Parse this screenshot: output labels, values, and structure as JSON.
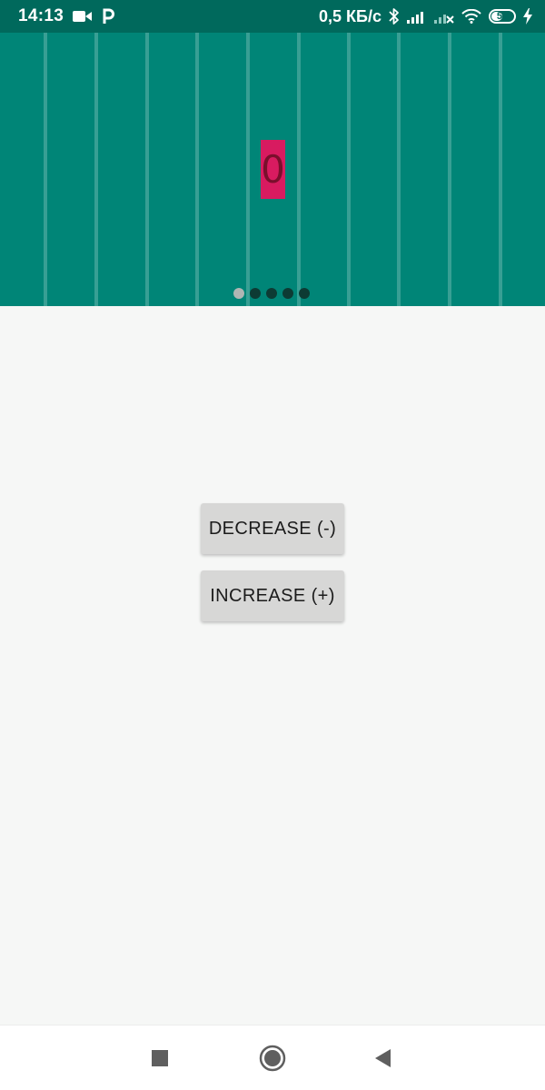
{
  "status_bar": {
    "time": "14:13",
    "network_speed": "0,5 КБ/с",
    "battery_level": "50",
    "battery_percent": 50,
    "icons": [
      "video-camera-icon",
      "parking-icon",
      "bluetooth-icon",
      "signal-icon",
      "signal-no-service-icon",
      "wifi-icon",
      "battery-icon",
      "charging-icon"
    ]
  },
  "header": {
    "counter_value": "0",
    "counter_color": "#d81b60",
    "background_color": "#008577",
    "pager": {
      "total_pages": 5,
      "active_index": 0
    }
  },
  "actions": {
    "decrease_label": "DECREASE (-)",
    "increase_label": "INCREASE (+)"
  },
  "nav_bar": {
    "icons": [
      "recents-square-icon",
      "home-circle-icon",
      "back-triangle-icon"
    ]
  }
}
